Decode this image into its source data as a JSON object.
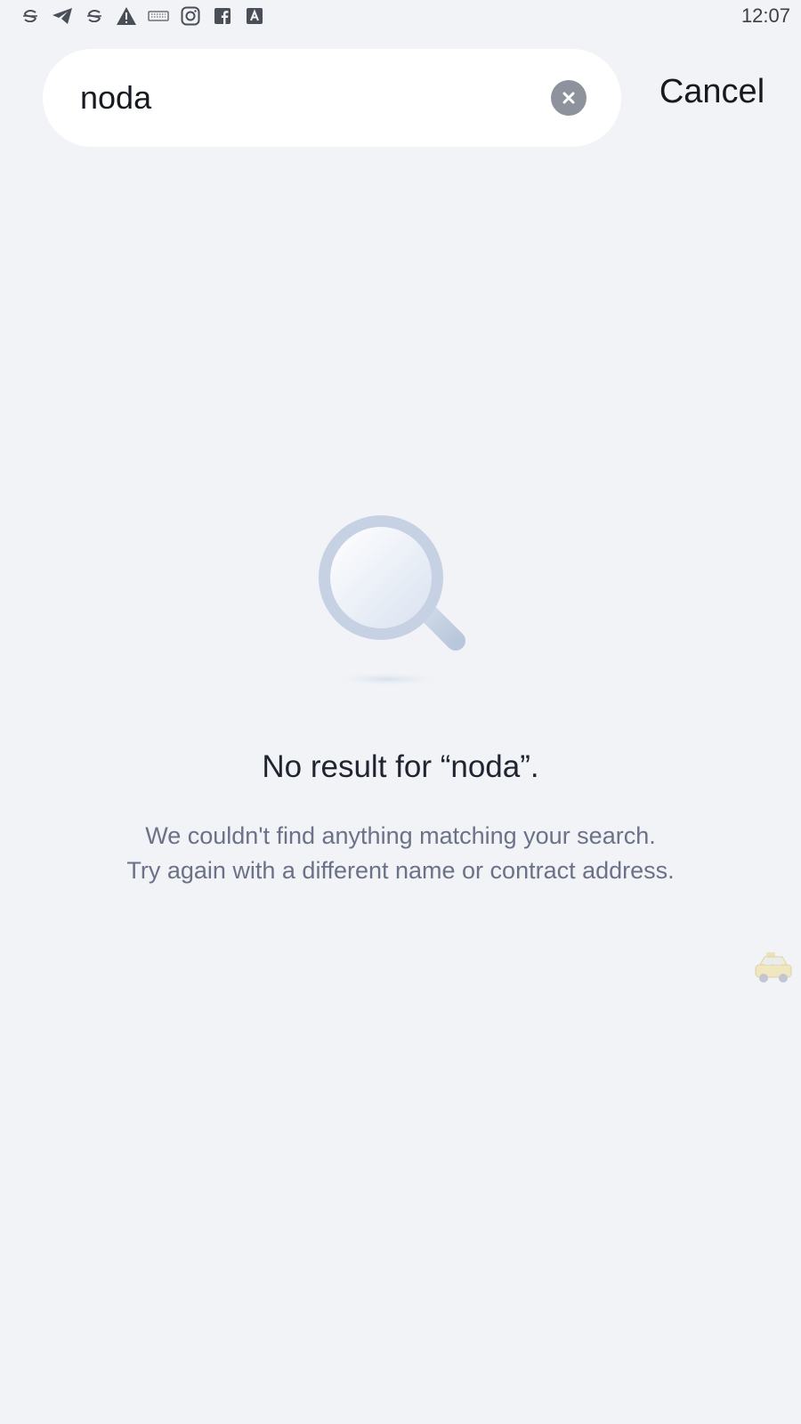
{
  "status_bar": {
    "time": "12:07",
    "icons": [
      "s-icon",
      "telegram-icon",
      "s-icon",
      "warning-icon",
      "keyboard-icon",
      "instagram-icon",
      "facebook-icon",
      "a-icon"
    ]
  },
  "search": {
    "query": "noda",
    "cancel_label": "Cancel"
  },
  "empty_state": {
    "title": "No result for “noda”.",
    "line1": "We couldn't find anything matching your search.",
    "line2": "Try again with a different name or contract address."
  },
  "colors": {
    "background": "#f1f3f6",
    "search_bg": "#ffffff",
    "clear_button": "#8d929c",
    "text_primary": "#1f2430",
    "text_secondary": "#6b7288",
    "illustration": "#c7d2e3"
  }
}
